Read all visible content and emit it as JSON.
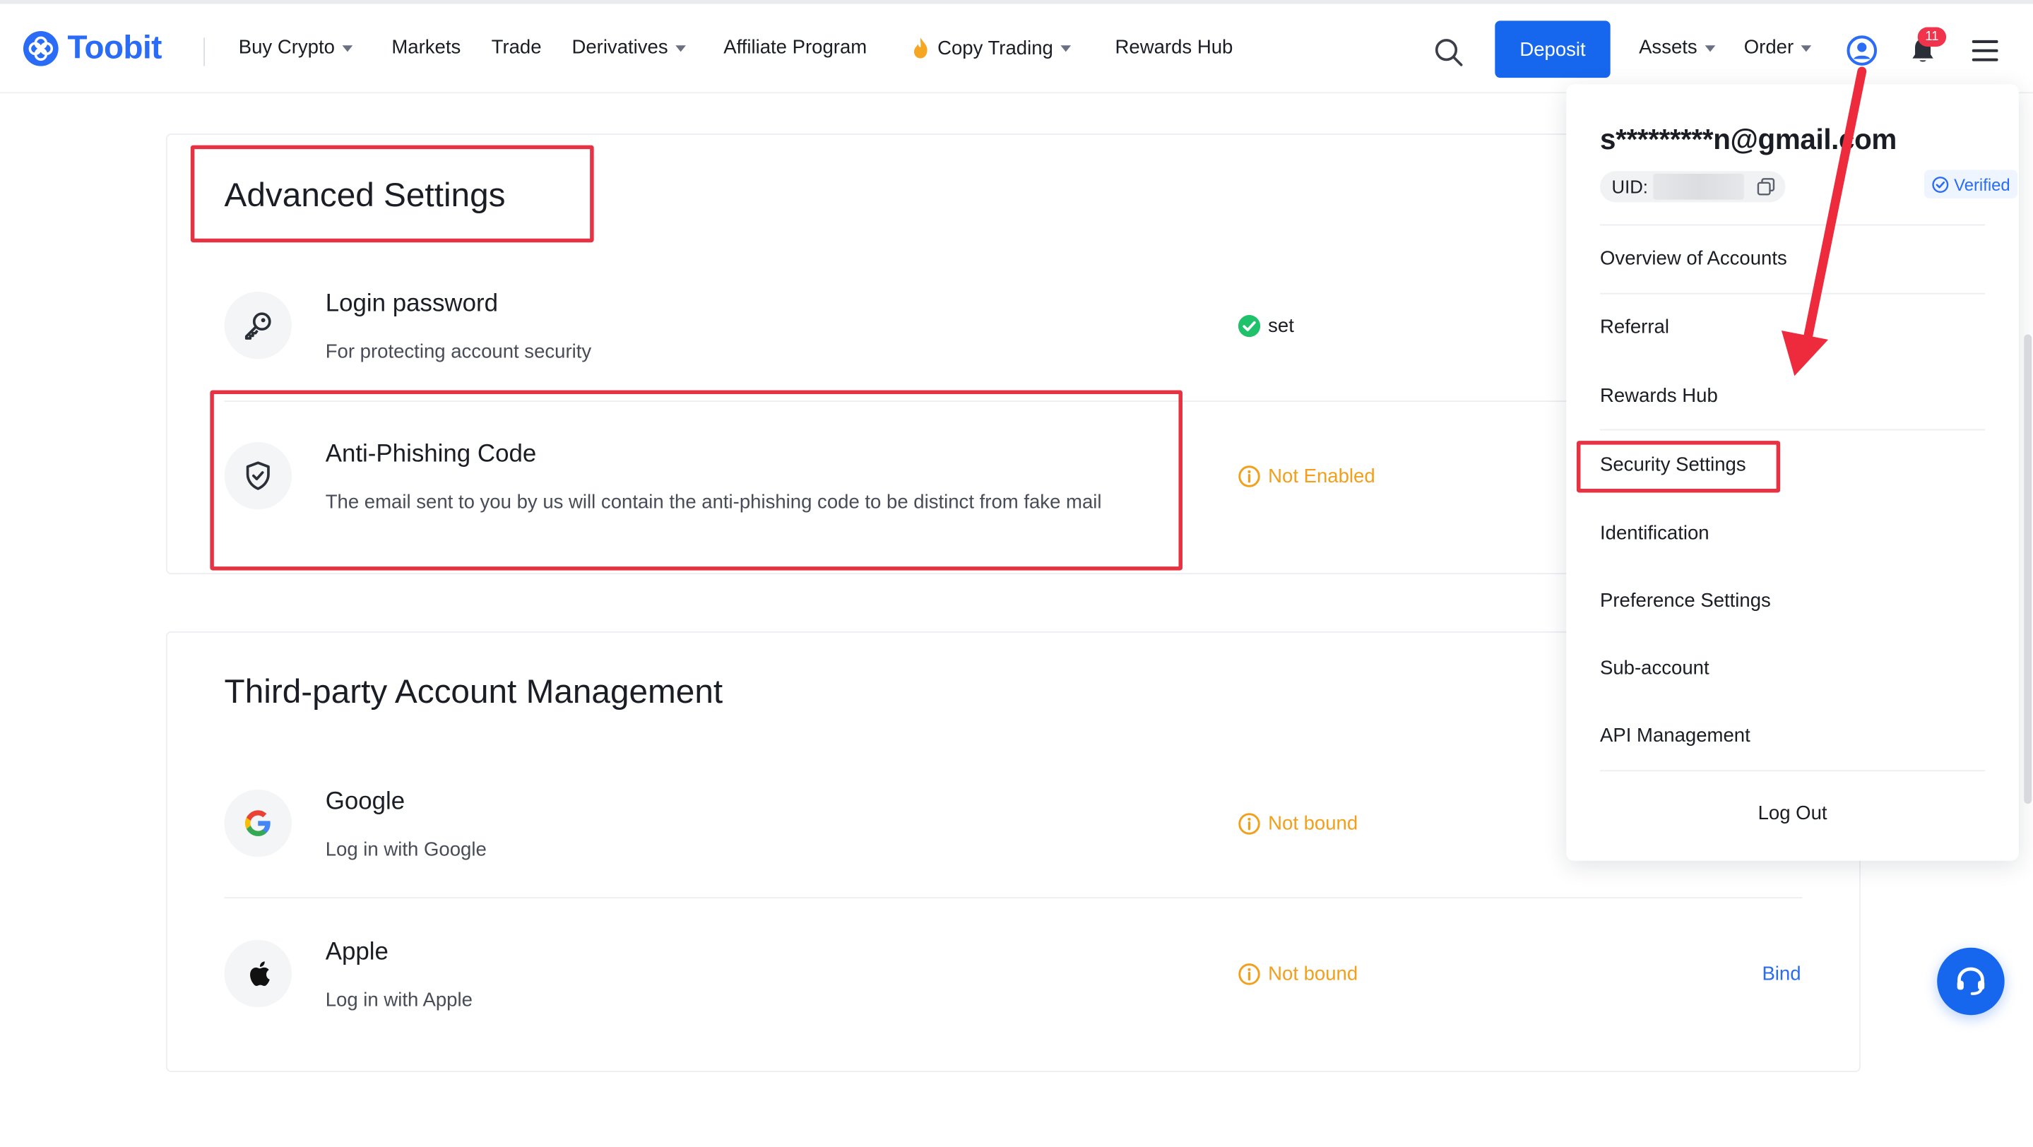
{
  "header": {
    "logo_text": "Toobit",
    "nav": [
      {
        "label": "Buy Crypto",
        "dropdown": true
      },
      {
        "label": "Markets",
        "dropdown": false
      },
      {
        "label": "Trade",
        "dropdown": false
      },
      {
        "label": "Derivatives",
        "dropdown": true
      },
      {
        "label": "Affiliate Program",
        "dropdown": false
      },
      {
        "label": "Copy Trading",
        "dropdown": true,
        "icon": "flame-icon"
      },
      {
        "label": "Rewards Hub",
        "dropdown": false
      }
    ],
    "deposit_label": "Deposit",
    "assets_label": "Assets",
    "order_label": "Order",
    "notification_count": "11"
  },
  "advanced_settings": {
    "title": "Advanced Settings",
    "rows": [
      {
        "icon": "key-icon",
        "title": "Login password",
        "desc": "For protecting account security",
        "status": "set",
        "status_kind": "ok"
      },
      {
        "icon": "shield-check-icon",
        "title": "Anti-Phishing Code",
        "desc": "The email sent to you by us will contain the anti-phishing code to be distinct from fake mail",
        "status": "Not Enabled",
        "status_kind": "warn"
      }
    ]
  },
  "third_party": {
    "title": "Third-party Account Management",
    "rows": [
      {
        "icon": "google-icon",
        "title": "Google",
        "desc": "Log in with Google",
        "status": "Not bound",
        "status_kind": "warn"
      },
      {
        "icon": "apple-icon",
        "title": "Apple",
        "desc": "Log in with Apple",
        "status": "Not bound",
        "status_kind": "warn",
        "action": "Bind"
      }
    ]
  },
  "account_menu": {
    "email": "s*********n@gmail.com",
    "uid_label": "UID:",
    "verified_label": "Verified",
    "items": [
      "Overview of Accounts",
      "Referral",
      "Rewards Hub",
      "Security Settings",
      "Identification",
      "Preference Settings",
      "Sub-account",
      "API Management"
    ],
    "logout_label": "Log Out"
  },
  "colors": {
    "brand": "#2a6cf6",
    "deposit": "#1767ee",
    "warning": "#f2a01b",
    "success": "#1fc16b",
    "annotation": "#e63343",
    "badge": "#f0344c"
  }
}
